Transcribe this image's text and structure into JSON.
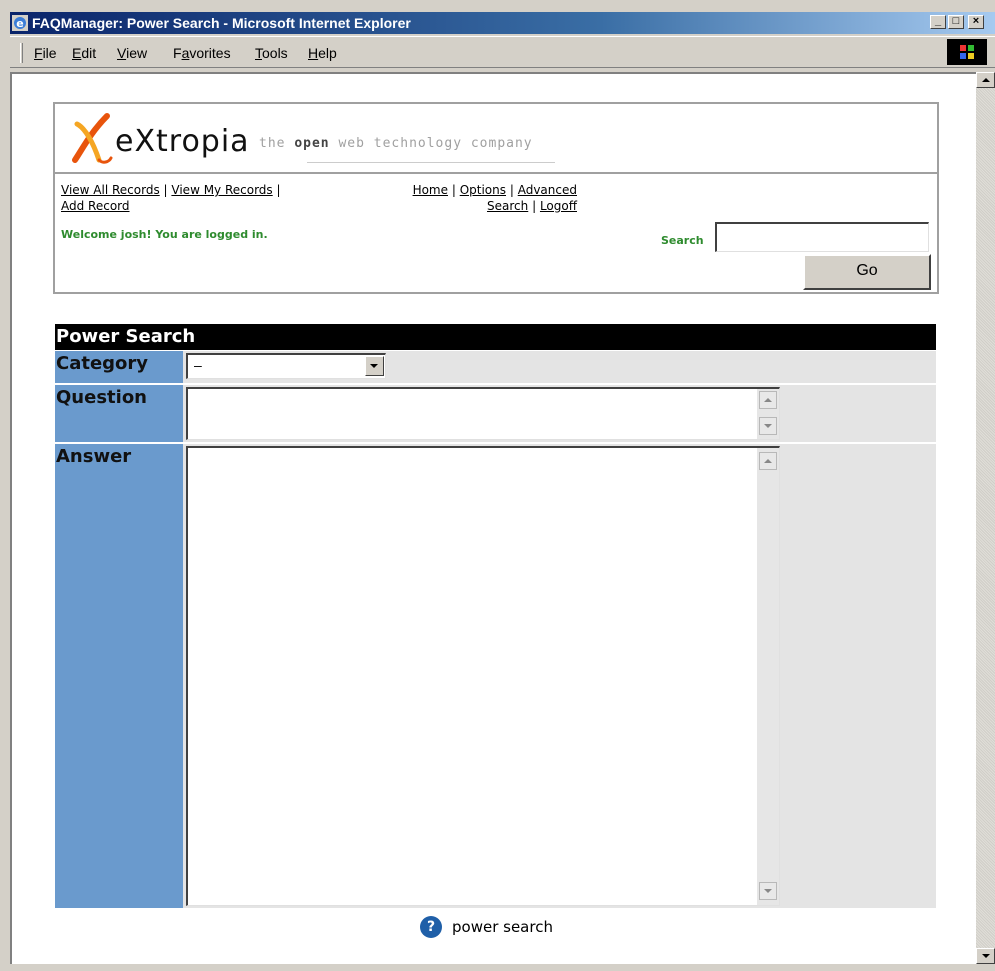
{
  "window": {
    "title": "FAQManager: Power Search - Microsoft Internet Explorer",
    "icon": "ie-icon",
    "controls": [
      "minimize",
      "maximize",
      "close"
    ]
  },
  "menubar": {
    "items": [
      {
        "accel": "F",
        "rest": "ile"
      },
      {
        "accel": "E",
        "rest": "dit"
      },
      {
        "accel": "V",
        "rest": "iew"
      },
      {
        "pre": "F",
        "accel": "a",
        "rest": "vorites"
      },
      {
        "accel": "T",
        "rest": "ools"
      },
      {
        "accel": "H",
        "rest": "elp"
      }
    ]
  },
  "header": {
    "logo_word": "eXtropia",
    "tagline_pre": "the ",
    "tagline_bold": "open",
    "tagline_post": " web technology company",
    "links": {
      "view_all": "View All Records",
      "view_my": "View My Records",
      "add_record": "Add Record",
      "home": "Home",
      "options": "Options",
      "advanced": "Advanced",
      "search": "Search",
      "logoff": "Logoff",
      "sep": "|"
    },
    "welcome": "Welcome josh! You are logged in.",
    "search_label": "Search",
    "search_value": "",
    "go_label": "Go"
  },
  "power_search": {
    "title": "Power Search",
    "category_label": "Category",
    "category_value": "–",
    "question_label": "Question",
    "question_value": "",
    "answer_label": "Answer",
    "answer_value": ""
  },
  "footer": {
    "help_icon": "?",
    "help_text": "power search"
  },
  "colors": {
    "label_bg": "#6a9acd",
    "welcome_green": "#2e8b2e",
    "title_bar": "#0a246a"
  }
}
